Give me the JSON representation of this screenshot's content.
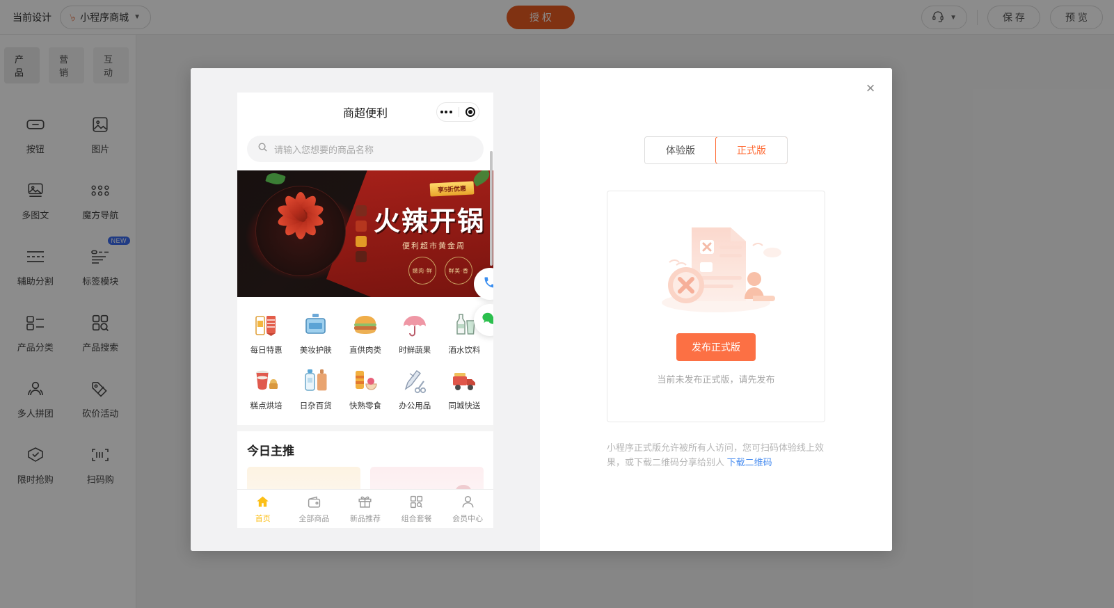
{
  "topbar": {
    "current_design_label": "当前设计",
    "project_name": "小程序商城",
    "project_icon": "mini-program-icon",
    "caret_icon": "chevron-down-icon",
    "authorize_label": "授 权",
    "headset_icon": "headset-icon",
    "save_label": "保 存",
    "preview_label": "预 览"
  },
  "left_panel": {
    "tabs": [
      {
        "label": "产品",
        "active": true
      },
      {
        "label": "营销",
        "active": false
      },
      {
        "label": "互动",
        "active": false
      }
    ],
    "components": [
      {
        "label": "按钮",
        "icon": "button-icon",
        "badge": ""
      },
      {
        "label": "图片",
        "icon": "image-icon",
        "badge": ""
      },
      {
        "label": "多图文",
        "icon": "multi-image-text-icon",
        "badge": ""
      },
      {
        "label": "魔方导航",
        "icon": "grid-nav-icon",
        "badge": ""
      },
      {
        "label": "辅助分割",
        "icon": "divider-icon",
        "badge": ""
      },
      {
        "label": "标签模块",
        "icon": "tag-module-icon",
        "badge": "NEW"
      },
      {
        "label": "产品分类",
        "icon": "product-category-icon",
        "badge": ""
      },
      {
        "label": "产品搜索",
        "icon": "product-search-icon",
        "badge": ""
      },
      {
        "label": "多人拼团",
        "icon": "group-buy-icon",
        "badge": ""
      },
      {
        "label": "砍价活动",
        "icon": "bargain-icon",
        "badge": ""
      },
      {
        "label": "限时抢购",
        "icon": "flash-sale-icon",
        "badge": ""
      },
      {
        "label": "扫码购",
        "icon": "scan-buy-icon",
        "badge": ""
      }
    ]
  },
  "modal": {
    "close_icon": "close-icon",
    "segments": [
      {
        "label": "体验版",
        "active": false
      },
      {
        "label": "正式版",
        "active": true
      }
    ],
    "illustration": "empty-state-no-release-illustration",
    "publish_button": "发布正式版",
    "hint": "当前未发布正式版，请先发布",
    "description_text": "小程序正式版允许被所有人访问，您可扫码体验线上效果，或下载二维码分享给别人 ",
    "description_link": "下载二维码",
    "accent_color": "#fc7044",
    "active_tab_color": "#ff6c36",
    "link_color": "#4a8ef0"
  },
  "phone_preview": {
    "title": "商超便利",
    "capsule_more_icon": "more-dots-icon",
    "capsule_target_icon": "target-circle-icon",
    "search": {
      "icon": "search-icon",
      "placeholder": "请输入您想要的商品名称"
    },
    "banner": {
      "title": "火辣开锅",
      "subtitle": "便利超市黄金周",
      "badge": "享5折优惠",
      "stamp_left": "嫩肉·鲜",
      "stamp_right": "鲜美·香"
    },
    "categories": [
      {
        "label": "每日特惠",
        "icon": "daily-deal-icon"
      },
      {
        "label": "美妆护肤",
        "icon": "cosmetics-icon"
      },
      {
        "label": "直供肉类",
        "icon": "meat-burger-icon"
      },
      {
        "label": "时鲜蔬果",
        "icon": "umbrella-produce-icon"
      },
      {
        "label": "酒水饮料",
        "icon": "drinks-icon"
      },
      {
        "label": "糕点烘培",
        "icon": "bakery-icon"
      },
      {
        "label": "日杂百货",
        "icon": "household-icon"
      },
      {
        "label": "快熟零食",
        "icon": "snacks-icon"
      },
      {
        "label": "办公用品",
        "icon": "office-supplies-icon"
      },
      {
        "label": "同城快送",
        "icon": "delivery-truck-icon"
      }
    ],
    "fabs": [
      {
        "icon": "phone-call-icon",
        "color": "#3a8ef0"
      },
      {
        "icon": "wechat-icon",
        "color": "#2bbf4d"
      }
    ],
    "section_title": "今日主推",
    "tabbar": [
      {
        "label": "首页",
        "icon": "home-icon",
        "active": true
      },
      {
        "label": "全部商品",
        "icon": "wallet-icon",
        "active": false
      },
      {
        "label": "新品推荐",
        "icon": "gift-icon",
        "active": false
      },
      {
        "label": "组合套餐",
        "icon": "grid-search-icon",
        "active": false
      },
      {
        "label": "会员中心",
        "icon": "user-icon",
        "active": false
      }
    ],
    "active_tab_color": "#fcbf17"
  }
}
